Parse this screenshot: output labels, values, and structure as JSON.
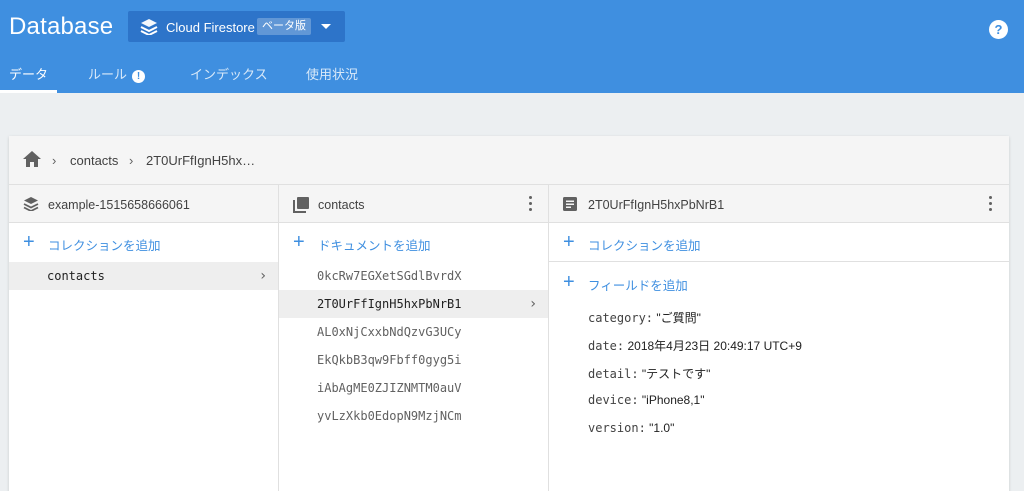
{
  "app": {
    "title": "Database",
    "db_name": "Cloud Firestore",
    "beta_label": "ベータ版",
    "help_glyph": "?"
  },
  "tabs": [
    {
      "label": "データ",
      "active": true
    },
    {
      "label": "ルール",
      "warning": "!"
    },
    {
      "label": "インデックス"
    },
    {
      "label": "使用状況"
    }
  ],
  "breadcrumb": {
    "items": [
      "contacts",
      "2T0UrFfIgnH5hx…"
    ]
  },
  "columns": {
    "root": {
      "title": "example-1515658666061",
      "add_label": "コレクションを追加",
      "items": [
        {
          "label": "contacts",
          "selected": true
        }
      ]
    },
    "collection": {
      "title": "contacts",
      "add_label": "ドキュメントを追加",
      "items": [
        {
          "label": "0kcRw7EGXetSGdlBvrdX"
        },
        {
          "label": "2T0UrFfIgnH5hxPbNrB1",
          "selected": true
        },
        {
          "label": "AL0xNjCxxbNdQzvG3UCy"
        },
        {
          "label": "EkQkbB3qw9Fbff0gyg5i"
        },
        {
          "label": "iAbAgME0ZJIZNMTM0auV"
        },
        {
          "label": "yvLzXkb0EdopN9MzjNCm"
        }
      ]
    },
    "document": {
      "title": "2T0UrFfIgnH5hxPbNrB1",
      "add_collection_label": "コレクションを追加",
      "add_field_label": "フィールドを追加",
      "fields": [
        {
          "key": "category:",
          "value": "\"ご質問\""
        },
        {
          "key": "date:",
          "value": "2018年4月23日 20:49:17 UTC+9"
        },
        {
          "key": "detail:",
          "value": "\"テストです\""
        },
        {
          "key": "device:",
          "value": "\"iPhone8,1\""
        },
        {
          "key": "version:",
          "value": "\"1.0\""
        }
      ]
    }
  },
  "colors": {
    "header": "#3f8fe0",
    "accent": "#3f8fe0"
  }
}
